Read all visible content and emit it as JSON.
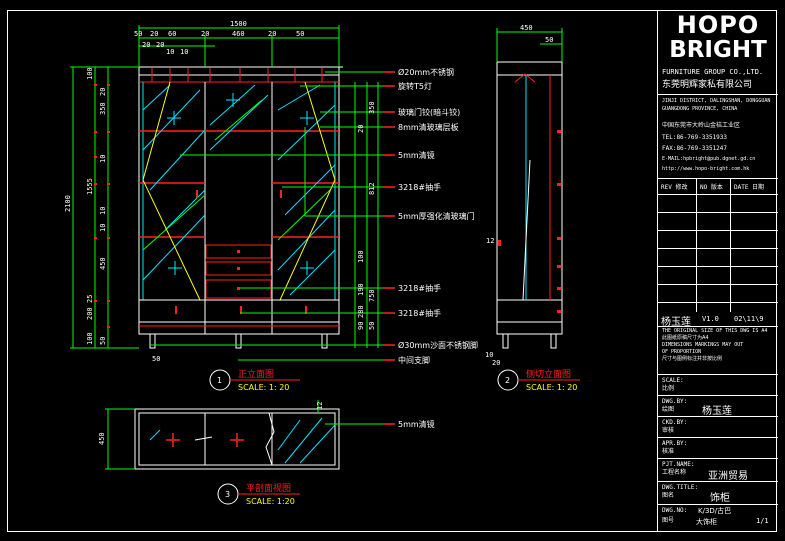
{
  "dims": {
    "overall_width": "1500",
    "depth": "450",
    "top_parts": [
      "50",
      "20",
      "60",
      "20",
      "460",
      "20",
      "50"
    ],
    "top_small": [
      "20",
      "20",
      "10",
      "10"
    ],
    "depth_part": "50",
    "height_total": "2100",
    "height_mid": "1555",
    "left_parts": [
      "100",
      "20",
      "350",
      "10",
      "10",
      "10",
      "450",
      "25",
      "200",
      "100",
      "50"
    ],
    "right_parts": [
      "350",
      "20",
      "100",
      "190",
      "280",
      "90",
      "50"
    ],
    "right_total": "812",
    "right_total2": "750",
    "bottom_small": "50",
    "side_small": "12",
    "plan_depth": "450",
    "plan_small": "12",
    "side_bottom": [
      "10",
      "20"
    ],
    "front_bottom": "50"
  },
  "callouts": [
    "Ø20mm不锈钢",
    "旋转T5灯",
    "玻璃门铰(暗斗铰)",
    "8mm清玻璃层板",
    "5mm清镜",
    "3218#抽手",
    "5mm厚强化清玻璃门",
    "3218#抽手",
    "3218#抽手",
    "Ø30mm沙面不锈钢脚",
    "中间支脚"
  ],
  "plan_callout": "5mm清镜",
  "views": [
    {
      "num": "1",
      "title": "正立面图",
      "scale": "SCALE: 1: 20"
    },
    {
      "num": "2",
      "title": "侧切立面图",
      "scale": "SCALE: 1: 20"
    },
    {
      "num": "3",
      "title": "平剖面视图",
      "scale": "SCALE: 1:20"
    }
  ],
  "title_block": {
    "logo_line1": "HOPO",
    "logo_line2": "BRIGHT",
    "company_en": "FURNITURE GROUP CO.,LTD.",
    "company_cn": "东莞明辉家私有限公司",
    "address_lines": [
      "JINJI DISTRICT, DALINGSHAN, DONGGUAN",
      "GUANGDONG PROVINCE, CHINA",
      "中国东莞市大岭山金桔工业区",
      "TEL:86-769-3351933",
      "FAX:86-769-3351247",
      "E-MAIL:hpbright@pub.dgnet.gd.cn",
      "http://www.hopo-bright.com.hk"
    ],
    "rev_header": [
      "REV 修改",
      "NO 版本",
      "DATE 日期"
    ],
    "designer": "杨玉莲",
    "version": "V1.0",
    "date": "02\\11\\9",
    "note_lines": [
      "THE ORIGINAL SIZE OF THIS DWG IS A4",
      "此图纸原稿尺寸为A4",
      "DIMENSIONS MARKINGS MAY OUT",
      "OF PROPORTION",
      "尺寸与图例标注并非按比例"
    ],
    "fields": [
      {
        "en": "SCALE:",
        "cn": "比例",
        "value": ""
      },
      {
        "en": "DWG.BY:",
        "cn": "绘图",
        "value": "杨玉莲"
      },
      {
        "en": "CKD.BY:",
        "cn": "审核",
        "value": ""
      },
      {
        "en": "APR.BY:",
        "cn": "核准",
        "value": ""
      },
      {
        "en": "PJT.NAME:",
        "cn": "工程名称",
        "value": "亚洲贸易"
      },
      {
        "en": "DWG.TITLE:",
        "cn": "图名",
        "value": "饰柜"
      },
      {
        "en": "DWG.NO:",
        "cn": "图号",
        "value": "K/3D/古巴",
        "value2": "大饰柜",
        "page": "1/1"
      }
    ]
  },
  "colors": {
    "line": "#ffffff",
    "red": "#ff2020",
    "green": "#00ff00",
    "cyan": "#00e5ff",
    "yellow": "#ffff00",
    "magenta": "#ff40ff"
  }
}
